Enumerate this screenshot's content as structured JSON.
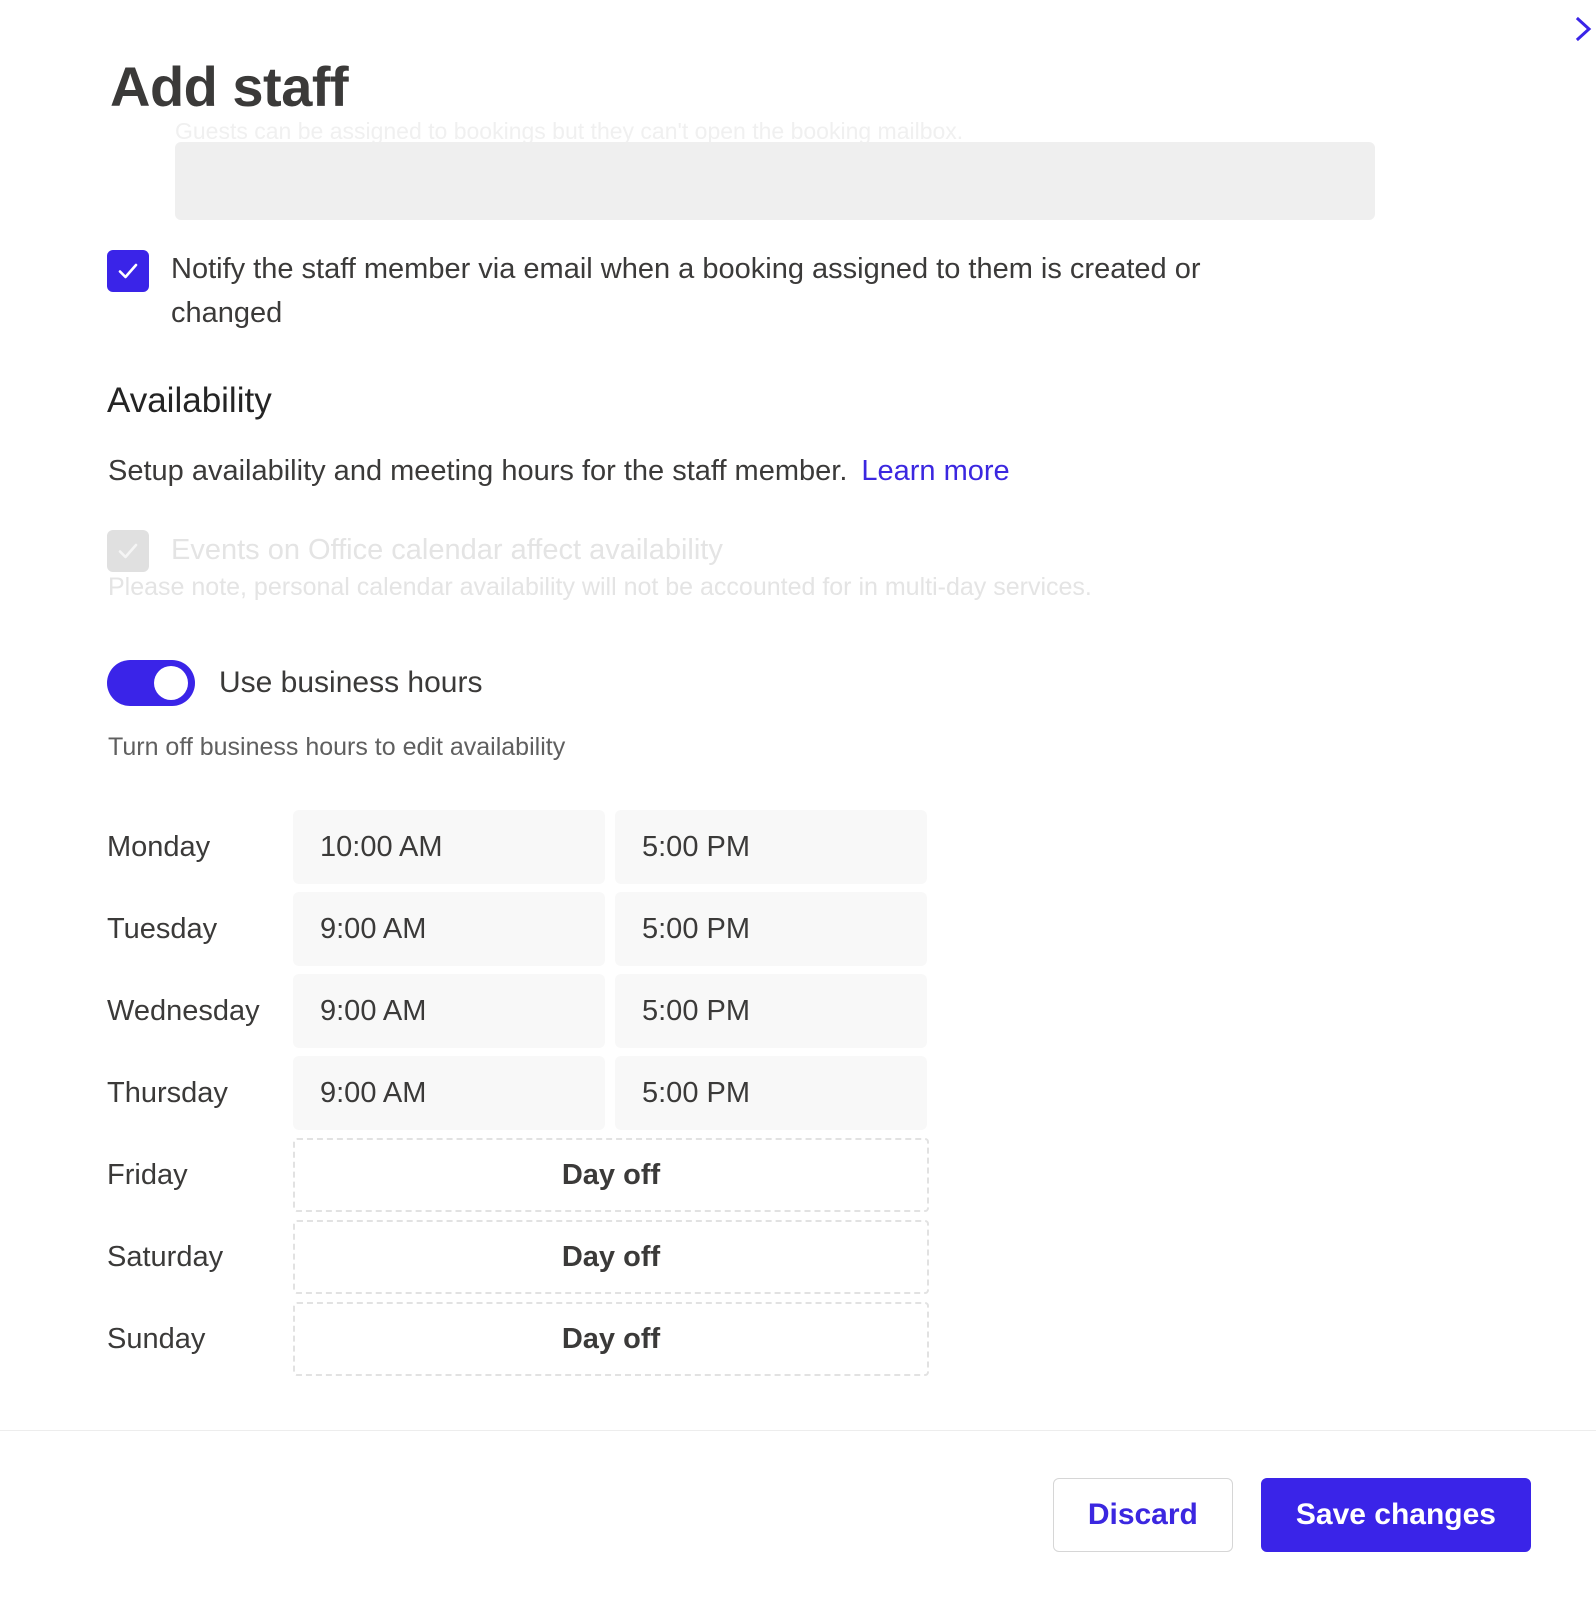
{
  "dialog": {
    "title": "Add staff",
    "close_icon": "close-chevron-icon"
  },
  "ghost_hint": {
    "text": "Guests can be assigned to bookings but they can't open the booking mailbox."
  },
  "notify": {
    "label": "Notify the staff member via email when a booking assigned to them is created or changed",
    "checked": true
  },
  "availability": {
    "heading": "Availability",
    "description": "Setup availability and meeting hours for the staff member.",
    "learn_more": "Learn more",
    "office_calendar": {
      "label": "Events on Office calendar affect availability",
      "note": "Please note, personal calendar availability will not be accounted for in multi-day services.",
      "checked": true,
      "disabled": true
    },
    "business_hours": {
      "label": "Use business hours",
      "hint": "Turn off business hours to edit availability",
      "on": true
    },
    "day_off_label": "Day off",
    "schedule": [
      {
        "day": "Monday",
        "start": "10:00 AM",
        "end": "5:00 PM",
        "day_off": false
      },
      {
        "day": "Tuesday",
        "start": "9:00 AM",
        "end": "5:00 PM",
        "day_off": false
      },
      {
        "day": "Wednesday",
        "start": "9:00 AM",
        "end": "5:00 PM",
        "day_off": false
      },
      {
        "day": "Thursday",
        "start": "9:00 AM",
        "end": "5:00 PM",
        "day_off": false
      },
      {
        "day": "Friday",
        "start": "",
        "end": "",
        "day_off": true
      },
      {
        "day": "Saturday",
        "start": "",
        "end": "",
        "day_off": true
      },
      {
        "day": "Sunday",
        "start": "",
        "end": "",
        "day_off": true
      }
    ]
  },
  "footer": {
    "discard_label": "Discard",
    "save_label": "Save changes"
  },
  "colors": {
    "accent": "#3a24e8",
    "link": "#3b27e0",
    "field_bg": "#f8f8f8",
    "disabled": "#e4e4e4"
  }
}
